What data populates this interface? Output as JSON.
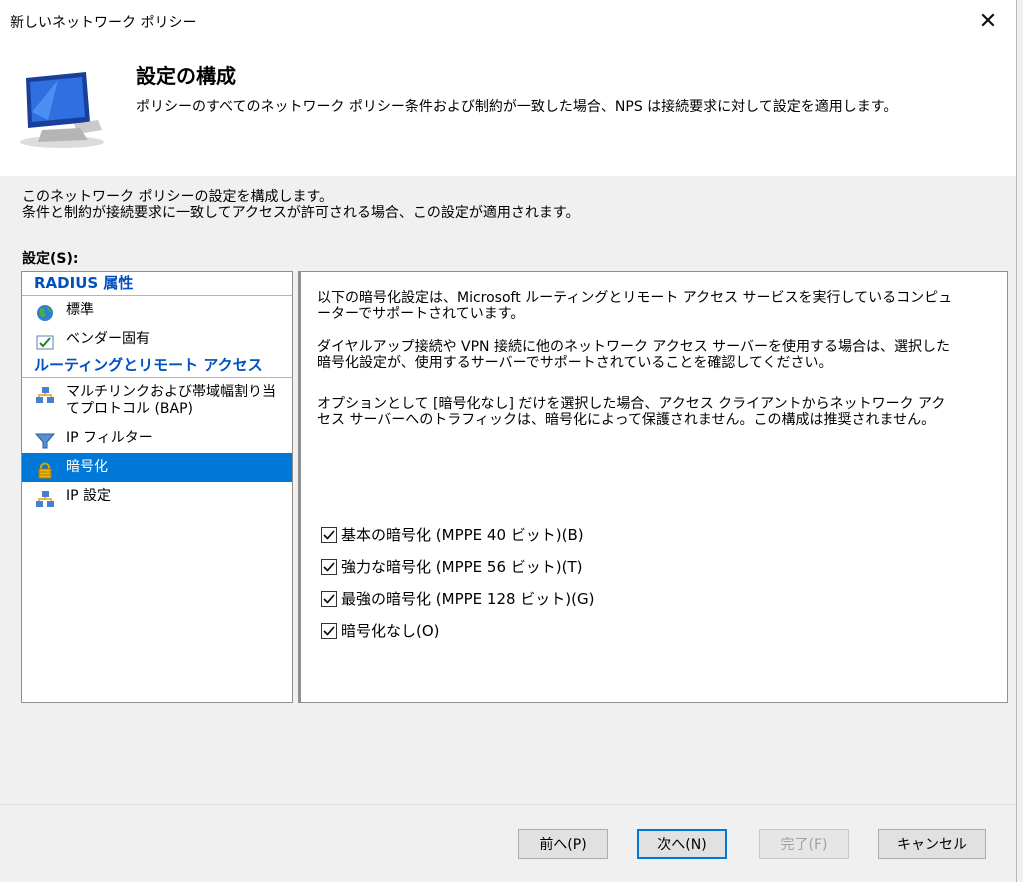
{
  "window": {
    "title": "新しいネットワーク ポリシー",
    "close_label": "✕"
  },
  "header": {
    "title": "設定の構成",
    "description": "ポリシーのすべてのネットワーク ポリシー条件および制約が一致した場合、NPS は接続要求に対して設定を適用します。"
  },
  "intro": {
    "line1": "このネットワーク ポリシーの設定を構成します。",
    "line2": "条件と制約が接続要求に一致してアクセスが許可される場合、この設定が適用されます。"
  },
  "settings_label": "設定(S):",
  "tree": {
    "group1": "RADIUS 属性",
    "standard": "標準",
    "vendor": "ベンダー固有",
    "group2": "ルーティングとリモート アクセス",
    "multilink": "マルチリンクおよび帯域幅割り当てプロトコル (BAP)",
    "ip_filter": "IP フィルター",
    "encryption": "暗号化",
    "ip_settings": "IP 設定"
  },
  "content": {
    "p1": "以下の暗号化設定は、Microsoft ルーティングとリモート アクセス サービスを実行しているコンピューターでサポートされています。",
    "p2": "ダイヤルアップ接続や VPN 接続に他のネットワーク アクセス サーバーを使用する場合は、選択した暗号化設定が、使用するサーバーでサポートされていることを確認してください。",
    "p3": "オプションとして [暗号化なし] だけを選択した場合、アクセス クライアントからネットワーク アクセス サーバーへのトラフィックは、暗号化によって保護されません。この構成は推奨されません。",
    "cb_basic": "基本の暗号化 (MPPE 40 ビット)(B)",
    "cb_strong": "強力な暗号化 (MPPE 56 ビット)(T)",
    "cb_strongest": "最強の暗号化 (MPPE 128 ビット)(G)",
    "cb_none": "暗号化なし(O)"
  },
  "buttons": {
    "back": "前へ(P)",
    "next": "次へ(N)",
    "finish": "完了(F)",
    "cancel": "キャンセル"
  },
  "colors": {
    "selection": "#0078d7",
    "group_header": "#0050c0"
  }
}
